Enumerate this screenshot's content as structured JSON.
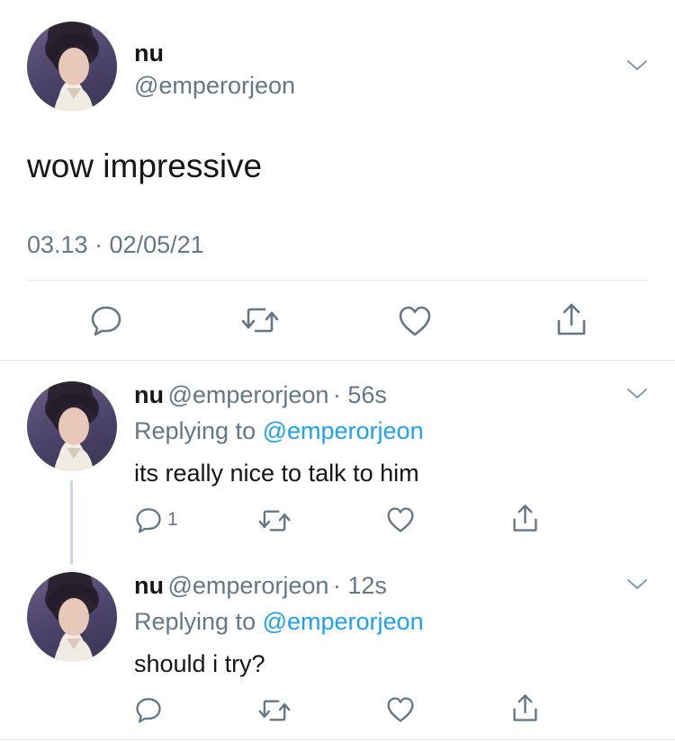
{
  "main_tweet": {
    "name": "nu",
    "handle": "@emperorjeon",
    "text": "wow impressive",
    "timestamp": "03.13 · 02/05/21"
  },
  "replies": [
    {
      "name": "nu",
      "handle": "@emperorjeon",
      "time": "· 56s",
      "replying_prefix": "Replying to ",
      "replying_to": "@emperorjeon",
      "text": "its really nice to talk to him",
      "reply_count": "1"
    },
    {
      "name": "nu",
      "handle": "@emperorjeon",
      "time": "· 12s",
      "replying_prefix": "Replying to ",
      "replying_to": "@emperorjeon",
      "text": "should i try?"
    }
  ],
  "icons": {
    "reply": "reply-icon",
    "retweet": "retweet-icon",
    "like": "heart-icon",
    "share": "share-icon",
    "caret": "chevron-down-icon"
  },
  "colors": {
    "text": "#14171a",
    "secondary": "#657786",
    "link": "#1da1f2",
    "divider": "#e1e8ed"
  }
}
